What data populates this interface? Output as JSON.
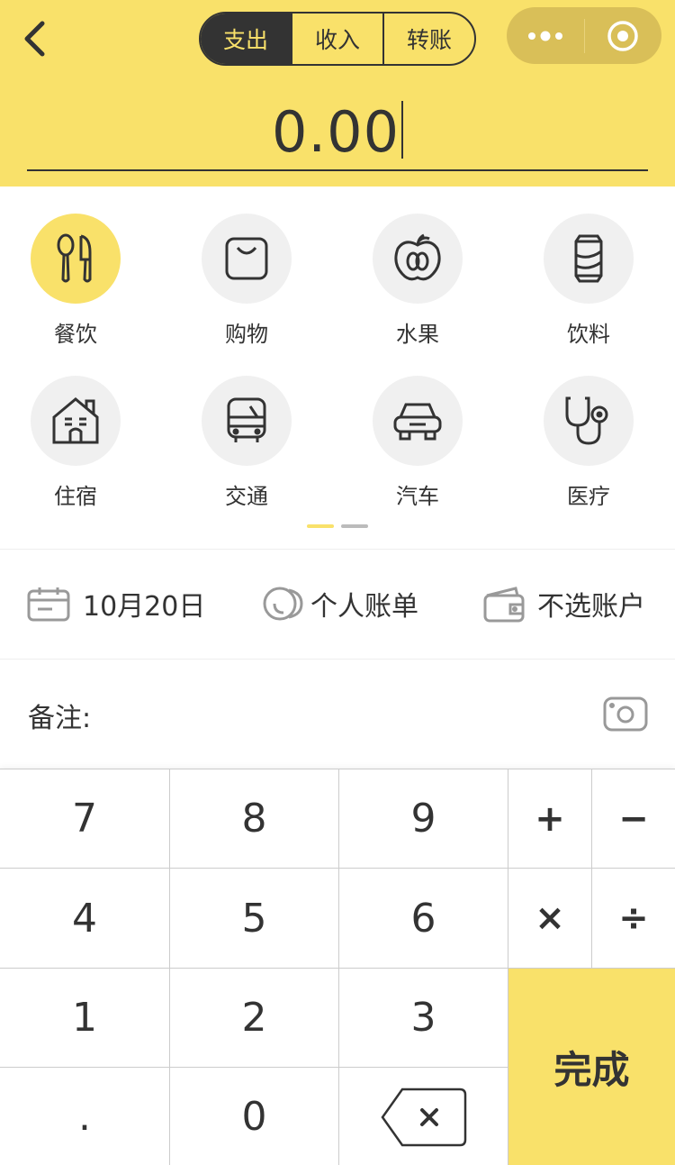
{
  "header": {
    "tabs": [
      "支出",
      "收入",
      "转账"
    ],
    "active_tab": 0,
    "amount": "0.00"
  },
  "categories": [
    {
      "label": "餐饮",
      "icon": "utensils-icon",
      "active": true
    },
    {
      "label": "购物",
      "icon": "shopping-bag-icon",
      "active": false
    },
    {
      "label": "水果",
      "icon": "apple-icon",
      "active": false
    },
    {
      "label": "饮料",
      "icon": "soda-can-icon",
      "active": false
    },
    {
      "label": "住宿",
      "icon": "house-icon",
      "active": false
    },
    {
      "label": "交通",
      "icon": "bus-icon",
      "active": false
    },
    {
      "label": "汽车",
      "icon": "car-icon",
      "active": false
    },
    {
      "label": "医疗",
      "icon": "stethoscope-icon",
      "active": false
    }
  ],
  "options": {
    "date": "10月20日",
    "ledger": "个人账单",
    "account": "不选账户"
  },
  "note": {
    "label": "备注:"
  },
  "keypad": {
    "k7": "7",
    "k8": "8",
    "k9": "9",
    "plus": "+",
    "minus": "−",
    "k4": "4",
    "k5": "5",
    "k6": "6",
    "times": "×",
    "divide": "÷",
    "k1": "1",
    "k2": "2",
    "k3": "3",
    "done": "完成",
    "dot": ".",
    "k0": "0"
  },
  "colors": {
    "accent": "#f9e16a",
    "dark": "#333333"
  }
}
